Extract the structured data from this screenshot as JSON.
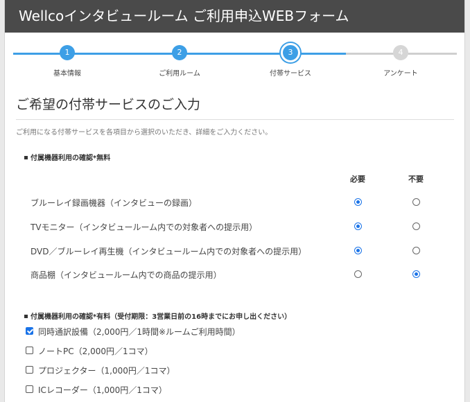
{
  "header": {
    "title": "Wellcoインタビュールーム ご利用申込WEBフォーム"
  },
  "stepper": {
    "steps": [
      {
        "number": "1",
        "label": "基本情報",
        "state": "done"
      },
      {
        "number": "2",
        "label": "ご利用ルーム",
        "state": "done"
      },
      {
        "number": "3",
        "label": "付帯サービス",
        "state": "current"
      },
      {
        "number": "4",
        "label": "アンケート",
        "state": "pending"
      }
    ]
  },
  "section": {
    "title": "ご希望の付帯サービスのご入力",
    "description": "ご利用になる付帯サービスを各項目から選択のいただき、詳細をご入力ください。"
  },
  "free_equipment": {
    "heading": "付属機器利用の確認*無料",
    "columns": {
      "need": "必要",
      "no_need": "不要"
    },
    "items": [
      {
        "label": "ブルーレイ録画機器（インタビューの録画）",
        "selected": "need"
      },
      {
        "label": "TVモニター（インタビュールーム内での対象者への提示用）",
        "selected": "need"
      },
      {
        "label": "DVD／ブルーレイ再生機（インタビュールーム内での対象者への提示用）",
        "selected": "need"
      },
      {
        "label": "商品棚（インタビュールーム内での商品の提示用）",
        "selected": "no_need"
      }
    ]
  },
  "paid_equipment": {
    "heading": "付属機器利用の確認*有料（受付期限：3営業日前の16時までにお申し出ください）",
    "items": [
      {
        "label": "同時通訳設備（2,000円／1時間※ルームご利用時間）",
        "checked": true
      },
      {
        "label": "ノートPC（2,000円／1コマ）",
        "checked": false
      },
      {
        "label": "プロジェクター（1,000円／1コマ）",
        "checked": false
      },
      {
        "label": "ICレコーダー（1,000円／1コマ）",
        "checked": false
      }
    ]
  },
  "colors": {
    "accent": "#3d9fe6",
    "radio": "#1a73e8",
    "header_bg": "#4a4a4a"
  }
}
